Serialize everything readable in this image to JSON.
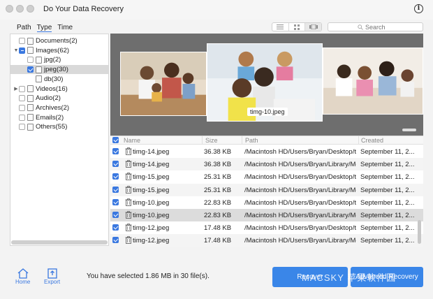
{
  "app": {
    "title": "Do Your Data Recovery"
  },
  "tabs": [
    "Path",
    "Type",
    "Time"
  ],
  "search": {
    "placeholder": "Search"
  },
  "tree": [
    {
      "label": "Documents(2)",
      "state": "off",
      "arrow": "",
      "indent": 0
    },
    {
      "label": "Images(62)",
      "state": "partial",
      "arrow": "▼",
      "indent": 0
    },
    {
      "label": "jpg(2)",
      "state": "off",
      "arrow": "",
      "indent": 1
    },
    {
      "label": "jpeg(30)",
      "state": "on",
      "arrow": "",
      "indent": 1,
      "selected": true
    },
    {
      "label": "db(30)",
      "state": "none",
      "arrow": "",
      "indent": 1
    },
    {
      "label": "Videos(16)",
      "state": "off",
      "arrow": "▶",
      "indent": 0
    },
    {
      "label": "Audio(2)",
      "state": "off",
      "arrow": "",
      "indent": 0
    },
    {
      "label": "Archives(2)",
      "state": "off",
      "arrow": "",
      "indent": 0
    },
    {
      "label": "Emails(2)",
      "state": "off",
      "arrow": "",
      "indent": 0
    },
    {
      "label": "Others(55)",
      "state": "off",
      "arrow": "",
      "indent": 0
    }
  ],
  "preview": {
    "caption": "timg-10.jpeg"
  },
  "table": {
    "headers": {
      "name": "Name",
      "size": "Size",
      "path": "Path",
      "created": "Created"
    },
    "rows": [
      {
        "name": "timg-14.jpeg",
        "size": "36.38 KB",
        "path": "/Macintosh HD/Users/Bryan/Desktop/ti...",
        "created": "September 11, 2..."
      },
      {
        "name": "timg-14.jpeg",
        "size": "36.38 KB",
        "path": "/Macintosh HD/Users/Bryan/Library/Mo...",
        "created": "September 11, 2..."
      },
      {
        "name": "timg-15.jpeg",
        "size": "25.31 KB",
        "path": "/Macintosh HD/Users/Bryan/Desktop/ti...",
        "created": "September 11, 2..."
      },
      {
        "name": "timg-15.jpeg",
        "size": "25.31 KB",
        "path": "/Macintosh HD/Users/Bryan/Library/Mo...",
        "created": "September 11, 2..."
      },
      {
        "name": "timg-10.jpeg",
        "size": "22.83 KB",
        "path": "/Macintosh HD/Users/Bryan/Desktop/ti...",
        "created": "September 11, 2..."
      },
      {
        "name": "timg-10.jpeg",
        "size": "22.83 KB",
        "path": "/Macintosh HD/Users/Bryan/Library/Mo...",
        "created": "September 11, 2...",
        "selected": true
      },
      {
        "name": "timg-12.jpeg",
        "size": "17.48 KB",
        "path": "/Macintosh HD/Users/Bryan/Desktop/ti...",
        "created": "September 11, 2..."
      },
      {
        "name": "timg-12.jpeg",
        "size": "17.48 KB",
        "path": "/Macintosh HD/Users/Bryan/Library/Mo...",
        "created": "September 11, 2..."
      }
    ]
  },
  "toolbar": {
    "home_label": "Home",
    "export_label": "Export"
  },
  "status": {
    "text": "You have selected 1.86 MB in 30 file(s)."
  },
  "buttons": {
    "recover": "Recover",
    "advanced": "Advanced Recovery"
  },
  "watermark": "MACSKY 苹果软件园",
  "colors": {
    "accent": "#3a78e0",
    "button": "#3a86e8",
    "preview_bg": "#6e6e6e"
  }
}
